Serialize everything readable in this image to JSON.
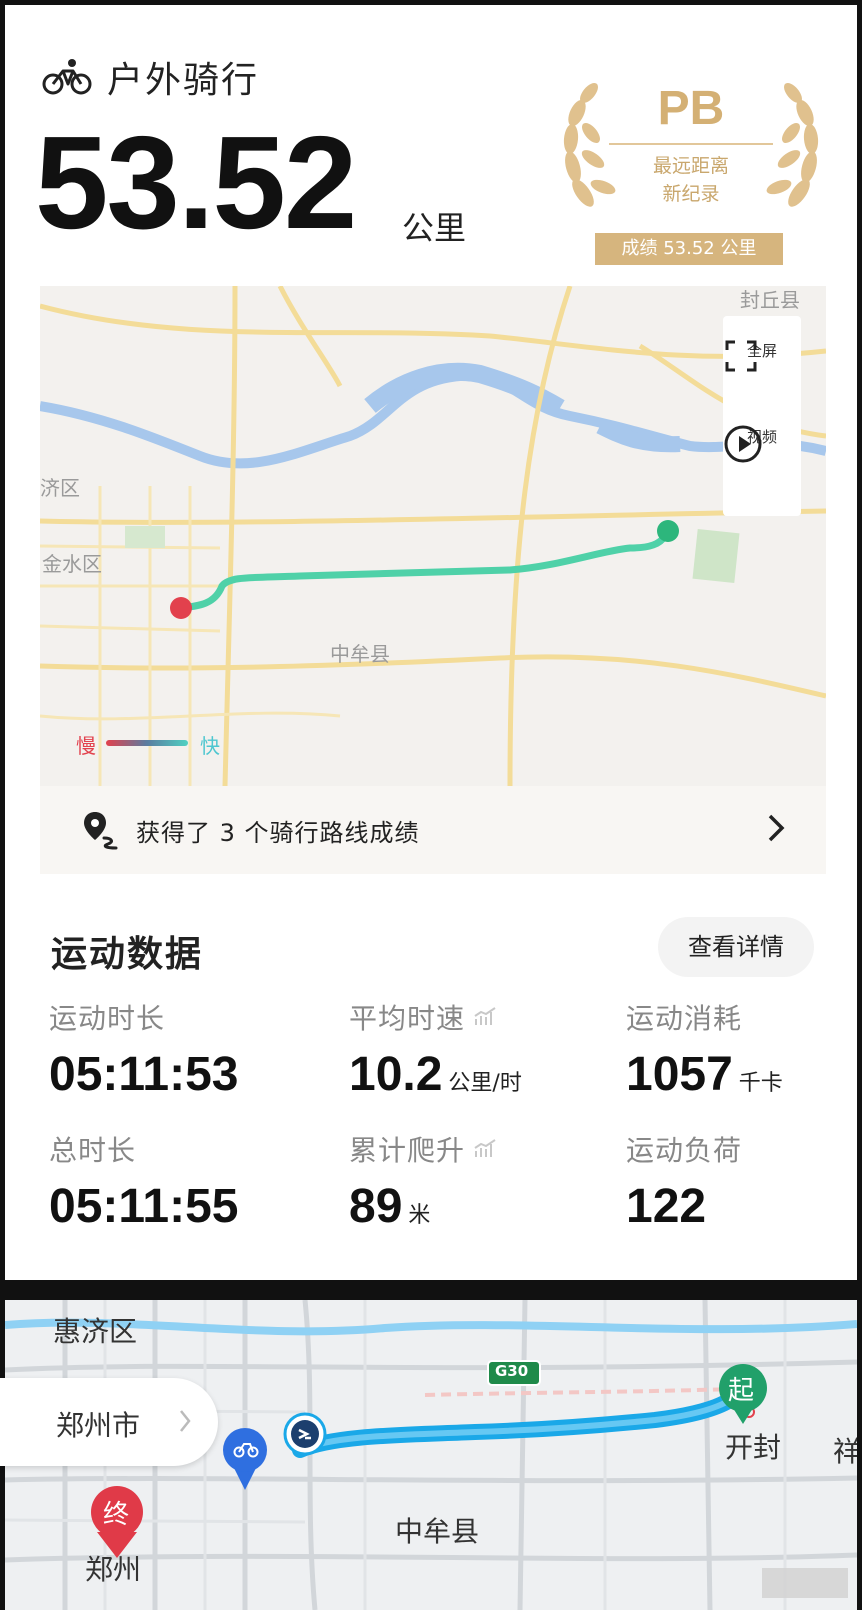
{
  "header": {
    "sport_icon": "bicycle-icon",
    "sport_name": "户外骑行",
    "distance": "53.52",
    "distance_unit": "公里"
  },
  "pb_badge": {
    "title": "PB",
    "subtitle_line1": "最远距离",
    "subtitle_line2": "新纪录",
    "score": "成绩 53.52 公里",
    "color": "#d6b57e"
  },
  "map": {
    "labels": {
      "top_right": "封丘县",
      "district_left": "济区",
      "district_jinshui": "金水区",
      "county": "中牟县"
    },
    "controls": {
      "fullscreen": "全屏",
      "video": "视频"
    },
    "legend": {
      "slow": "慢",
      "fast": "快"
    },
    "start_color": "#2db67c",
    "end_color": "#e2414d",
    "route_color": "#4fd1a8"
  },
  "route_bar": {
    "text": "获得了 3 个骑行路线成绩"
  },
  "stats": {
    "title": "运动数据",
    "details_button": "查看详情",
    "items": [
      {
        "label": "运动时长",
        "value": "05:11:53",
        "unit": ""
      },
      {
        "label": "平均时速",
        "value": "10.2",
        "unit": "公里/时"
      },
      {
        "label": "运动消耗",
        "value": "1057",
        "unit": "千卡"
      },
      {
        "label": "总时长",
        "value": "05:11:55",
        "unit": ""
      },
      {
        "label": "累计爬升",
        "value": "89",
        "unit": "米"
      },
      {
        "label": "运动负荷",
        "value": "122",
        "unit": ""
      }
    ]
  },
  "nav_map": {
    "district": "惠济区",
    "city": "郑州市",
    "highway": "G30",
    "start_marker": "起",
    "end_marker": "终",
    "start_city": "开封",
    "end_city": "郑州",
    "county": "中牟县",
    "edge_char": "祥",
    "route_color": "#1aa8e8"
  }
}
